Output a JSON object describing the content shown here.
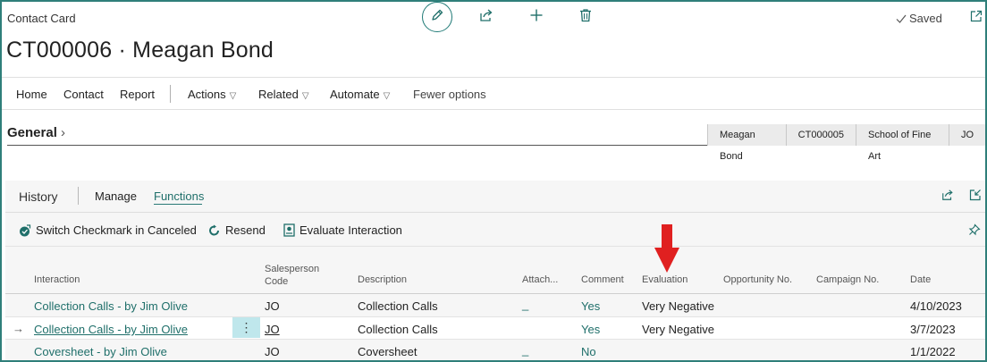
{
  "page": {
    "caption": "Contact Card",
    "title": "CT000006 · Meagan Bond",
    "saved_label": "Saved"
  },
  "actionbar": {
    "items": [
      "Home",
      "Contact",
      "Report"
    ],
    "menus": [
      "Actions",
      "Related",
      "Automate"
    ],
    "fewer": "Fewer options"
  },
  "general": {
    "label": "General",
    "chips": [
      "Meagan Bond",
      "CT000005",
      "School of Fine Art",
      "JO"
    ]
  },
  "history": {
    "title": "History",
    "tabs": [
      "Manage",
      "Functions"
    ],
    "functions": [
      "Switch Checkmark in Canceled",
      "Resend",
      "Evaluate Interaction"
    ],
    "columns": {
      "interaction": "Interaction",
      "salesperson_1": "Salesperson",
      "salesperson_2": "Code",
      "description": "Description",
      "attach": "Attach...",
      "comment": "Comment",
      "evaluation": "Evaluation",
      "opportunity": "Opportunity No.",
      "campaign": "Campaign No.",
      "date": "Date"
    },
    "rows": [
      {
        "interaction": "Collection Calls - by Jim Olive",
        "code": "JO",
        "description": "Collection Calls",
        "attach": "_",
        "comment": "Yes",
        "evaluation": "Very Negative",
        "date": "4/10/2023"
      },
      {
        "interaction": "Collection Calls - by Jim Olive",
        "code": "JO",
        "description": "Collection Calls",
        "attach": "",
        "comment": "Yes",
        "evaluation": "Very Negative",
        "date": "3/7/2023",
        "row_marker": "→",
        "menu": "⋮"
      },
      {
        "interaction": "Coversheet - by Jim Olive",
        "code": "JO",
        "description": "Coversheet",
        "attach": "_",
        "comment": "No",
        "evaluation": "",
        "date": "1/1/2022"
      }
    ]
  },
  "colors": {
    "accent": "#1f6f6a",
    "frame": "#2f7f7a",
    "annotation_arrow": "#e02020",
    "selected_cell": "#bfe7ec"
  },
  "icons": [
    "edit-icon",
    "share-icon",
    "add-icon",
    "delete-icon",
    "checkmark-icon",
    "popout-icon",
    "switch-checkmark-icon",
    "resend-icon",
    "evaluate-icon",
    "pin-icon",
    "collapse-icon",
    "red-arrow-icon"
  ]
}
